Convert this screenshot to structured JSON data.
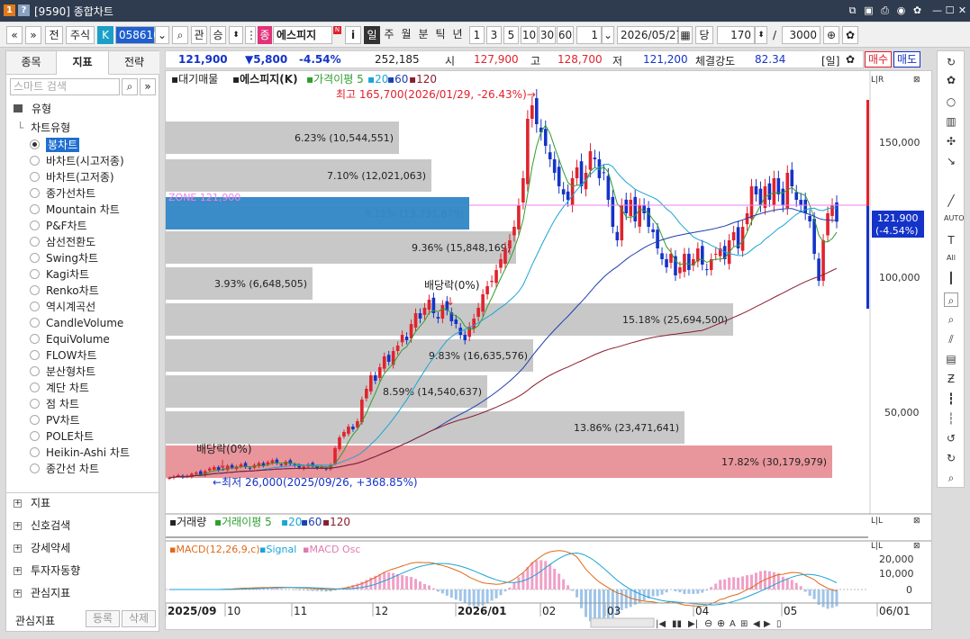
{
  "window": {
    "title": "[9590] 종합차트",
    "badge1": "1",
    "badge2": "?"
  },
  "toolbar": {
    "nav_prev": "«",
    "nav_down": "»",
    "prev_btn": "전",
    "type_btn": "주식",
    "k_badge": "K",
    "code": "058610",
    "gwan": "관",
    "seung": "승",
    "stock_badge": "종",
    "stock_name": "에스피지",
    "n_badge": "N",
    "info": "i",
    "periods": [
      "일",
      "주",
      "월",
      "분",
      "틱",
      "년"
    ],
    "units": [
      "1",
      "3",
      "5",
      "10",
      "30",
      "60"
    ],
    "count": "1",
    "date": "2026/05/27",
    "dang": "당",
    "bars": "170",
    "slash": "/",
    "total": "3000"
  },
  "tabs": [
    "종목",
    "지표",
    "전략"
  ],
  "search": {
    "placeholder": "스마트 검색"
  },
  "tree": {
    "root": "유형",
    "group": "차트유형",
    "selected": "봉차트",
    "items": [
      "봉차트",
      "바차트(시고저종)",
      "바차트(고저종)",
      "종가선차트",
      "Mountain 차트",
      "P&F차트",
      "삼선전환도",
      "Swing차트",
      "Kagi차트",
      "Renko차트",
      "역시계곡선",
      "CandleVolume",
      "EquiVolume",
      "FLOW차트",
      "분산형차트",
      "계단 차트",
      "점 차트",
      "PV차트",
      "POLE차트",
      "Heikin-Ashi 차트",
      "종간선 차트"
    ]
  },
  "sections": [
    "지표",
    "신호검색",
    "강세약세",
    "투자자동향",
    "관심지표"
  ],
  "bottom": {
    "label": "관심지표",
    "register": "등록",
    "delete": "삭제"
  },
  "info": {
    "price": "121,900",
    "change": "▼5,800",
    "rate": "-4.54%",
    "volume": "252,185",
    "open_l": "시",
    "open": "127,900",
    "high_l": "고",
    "high": "128,700",
    "low_l": "저",
    "low": "121,200",
    "strength_l": "체결강도",
    "strength": "82.34",
    "period": "[일]",
    "buy": "매수",
    "sell": "매도"
  },
  "price_legend": {
    "a": "대기매물",
    "b": "에스피지(K)",
    "c": "가격이평 5",
    "d": "20",
    "e": "60",
    "f": "120"
  },
  "annot": {
    "high": "최고 165,700(2026/01/29, -26.43%)→",
    "low": "←최저 26,000(2025/09/26, +368.85%)",
    "div1": "배당락(0%)",
    "div2": "배당락(0%)",
    "zone": "ZONE 121,900",
    "cur_price": "121,900",
    "cur_rate": "(-4.54%)"
  },
  "vol_legend": {
    "a": "거래량",
    "b": "거래이평 5",
    "c": "20",
    "d": "60",
    "e": "120"
  },
  "macd_legend": {
    "a": "MACD(12,26,9,c)",
    "b": "Signal",
    "c": "MACD Osc"
  },
  "x_labels": [
    "2025/09",
    "10",
    "11",
    "12",
    "2026/01",
    "02",
    "03",
    "04",
    "05",
    "06/01"
  ],
  "chart_data": {
    "type": "candlestick",
    "yticks": [
      "150,000",
      "100,000",
      "50,000"
    ],
    "macd_ticks": [
      "20,000",
      "10,000",
      "0"
    ],
    "supply_bars": [
      {
        "label": "6.23% (10,544,551)",
        "pct": 6.23
      },
      {
        "label": "7.10% (12,021,063)",
        "pct": 7.1
      },
      {
        "label": "8.11% (13,731,679)",
        "pct": 8.11,
        "highlight": true
      },
      {
        "label": "9.36% (15,848,169)",
        "pct": 9.36
      },
      {
        "label": "3.93% (6,648,505)",
        "pct": 3.93
      },
      {
        "label": "15.18% (25,694,500)",
        "pct": 15.18
      },
      {
        "label": "9.83% (16,635,576)",
        "pct": 9.83
      },
      {
        "label": "8.59% (14,540,637)",
        "pct": 8.59
      },
      {
        "label": "13.86% (23,471,641)",
        "pct": 13.86
      },
      {
        "label": "17.82% (30,179,979)",
        "pct": 17.82,
        "low": true
      }
    ],
    "closes": [
      27000,
      27500,
      28000,
      27200,
      27800,
      28500,
      29000,
      28200,
      29500,
      30500,
      31000,
      29800,
      30200,
      31500,
      30800,
      31200,
      32000,
      31000,
      30500,
      31800,
      32500,
      31500,
      32800,
      33500,
      32500,
      31800,
      33000,
      32200,
      31500,
      30800,
      31200,
      32000,
      31500,
      30600,
      31000,
      30200,
      31800,
      38000,
      42000,
      44000,
      46000,
      45000,
      48000,
      56000,
      60000,
      65000,
      63000,
      68000,
      72000,
      70000,
      74000,
      76000,
      80000,
      78000,
      84000,
      88000,
      86000,
      90000,
      93000,
      88000,
      86000,
      91000,
      89000,
      85000,
      84000,
      80000,
      78000,
      83000,
      86000,
      90000,
      95000,
      98000,
      100000,
      104000,
      108000,
      112000,
      115000,
      120000,
      128000,
      138000,
      160000,
      165000,
      158000,
      155000,
      150000,
      145000,
      140000,
      135000,
      132000,
      130000,
      138000,
      142000,
      135000,
      140000,
      148000,
      145000,
      138000,
      140000,
      130000,
      120000,
      115000,
      128000,
      125000,
      130000,
      122000,
      128000,
      125000,
      120000,
      118000,
      112000,
      108000,
      105000,
      110000,
      102000,
      105000,
      110000,
      104000,
      108000,
      112000,
      106000,
      104000,
      108000,
      110000,
      112000,
      108000,
      115000,
      118000,
      112000,
      120000,
      125000,
      135000,
      132000,
      128000,
      135000,
      130000,
      138000,
      132000,
      128000,
      140000,
      135000,
      130000,
      128000,
      125000,
      122000,
      110000,
      100000,
      115000,
      125000,
      128000,
      121900
    ],
    "ma_color_5": "#2e9e2e",
    "ma_color_20": "#1aa5d6",
    "ma_color_60": "#1f3fb0",
    "ma_color_120": "#8a1e2e",
    "up_color": "#e0232d",
    "down_color": "#1433c8"
  }
}
